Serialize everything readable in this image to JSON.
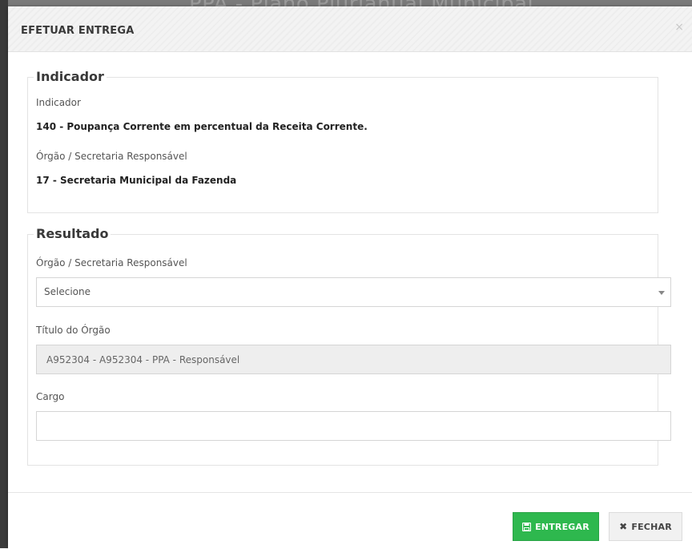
{
  "backdrop": {
    "title_fragment": "PPA - Plano Plurianual Municipal"
  },
  "modal": {
    "title": "EFETUAR ENTREGA",
    "close_glyph": "×"
  },
  "indicador": {
    "legend": "Indicador",
    "indicador_label": "Indicador",
    "indicador_value": "140 - Poupança Corrente em percentual da Receita Corrente.",
    "orgao_label": "Órgão / Secretaria Responsável",
    "orgao_value": "17 - Secretaria Municipal da Fazenda"
  },
  "resultado": {
    "legend": "Resultado",
    "orgao_label": "Órgão / Secretaria Responsável",
    "orgao_select_value": "Selecione",
    "titulo_label": "Título do Órgão",
    "titulo_value": "A952304 - A952304 - PPA - Responsável",
    "cargo_label": "Cargo",
    "cargo_value": ""
  },
  "footer": {
    "entregar_label": "ENTREGAR",
    "fechar_label": "FECHAR",
    "fechar_glyph": "✖"
  },
  "colors": {
    "entregar_green": "#2eb84e",
    "fechar_gray": "#f1f1f1",
    "header_bg": "#f3f3f3"
  },
  "icons": {
    "entregar": "save-icon",
    "fechar": "close-icon",
    "modal_close": "close-icon"
  }
}
